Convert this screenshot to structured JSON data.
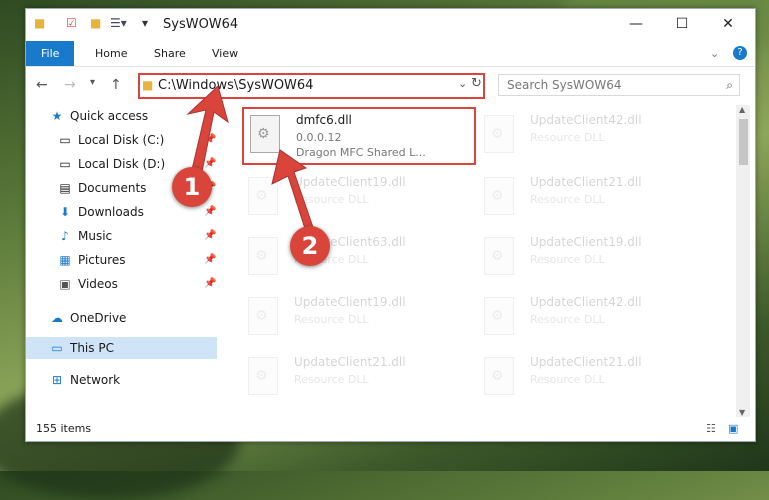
{
  "window": {
    "title": "SysWOW64"
  },
  "ribbon": {
    "tabs": [
      "File",
      "Home",
      "Share",
      "View"
    ]
  },
  "address": {
    "path": "C:\\Windows\\SysWOW64",
    "search_placeholder": "Search SysWOW64"
  },
  "sidebar": {
    "items": [
      {
        "label": "Quick access"
      },
      {
        "label": "Local Disk (C:)"
      },
      {
        "label": "Local Disk (D:)"
      },
      {
        "label": "Documents"
      },
      {
        "label": "Downloads"
      },
      {
        "label": "Music"
      },
      {
        "label": "Pictures"
      },
      {
        "label": "Videos"
      },
      {
        "label": "OneDrive"
      },
      {
        "label": "This PC"
      },
      {
        "label": "Network"
      }
    ]
  },
  "files": {
    "selected": {
      "name": "dmfc6.dll",
      "version": "0.0.0.12",
      "desc": "Dragon MFC Shared L..."
    },
    "others": [
      {
        "name": "UpdateClient42.dll",
        "desc": "Resource DLL"
      },
      {
        "name": "UpdateClient19.dll",
        "desc": "Resource DLL"
      },
      {
        "name": "UpdateClient21.dll",
        "desc": "Resource DLL"
      },
      {
        "name": "UpdateClient63.dll",
        "desc": "Resource DLL"
      },
      {
        "name": "UpdateClient19.dll",
        "desc": "Resource DLL"
      },
      {
        "name": "UpdateClient19.dll",
        "desc": "Resource DLL"
      },
      {
        "name": "UpdateClient42.dll",
        "desc": "Resource DLL"
      },
      {
        "name": "UpdateClient21.dll",
        "desc": "Resource DLL"
      },
      {
        "name": "UpdateClient21.dll",
        "desc": "Resource DLL"
      }
    ]
  },
  "status": {
    "count": "155 items"
  },
  "markers": [
    "1",
    "2"
  ],
  "colors": {
    "highlight": "#d9453b",
    "accent": "#1979ca"
  }
}
